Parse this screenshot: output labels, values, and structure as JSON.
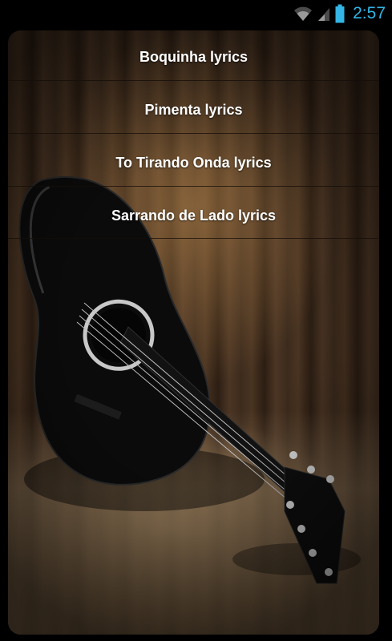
{
  "status_bar": {
    "time": "2:57",
    "icons": [
      "wifi-icon",
      "signal-icon",
      "battery-icon"
    ],
    "accent_color": "#33b5e5"
  },
  "lyrics_list": {
    "items": [
      {
        "label": "Boquinha lyrics"
      },
      {
        "label": "Pimenta lyrics"
      },
      {
        "label": "To Tirando Onda lyrics"
      },
      {
        "label": "Sarrando de Lado lyrics"
      }
    ]
  },
  "background": {
    "image": "guitar-on-wooden-wall"
  }
}
